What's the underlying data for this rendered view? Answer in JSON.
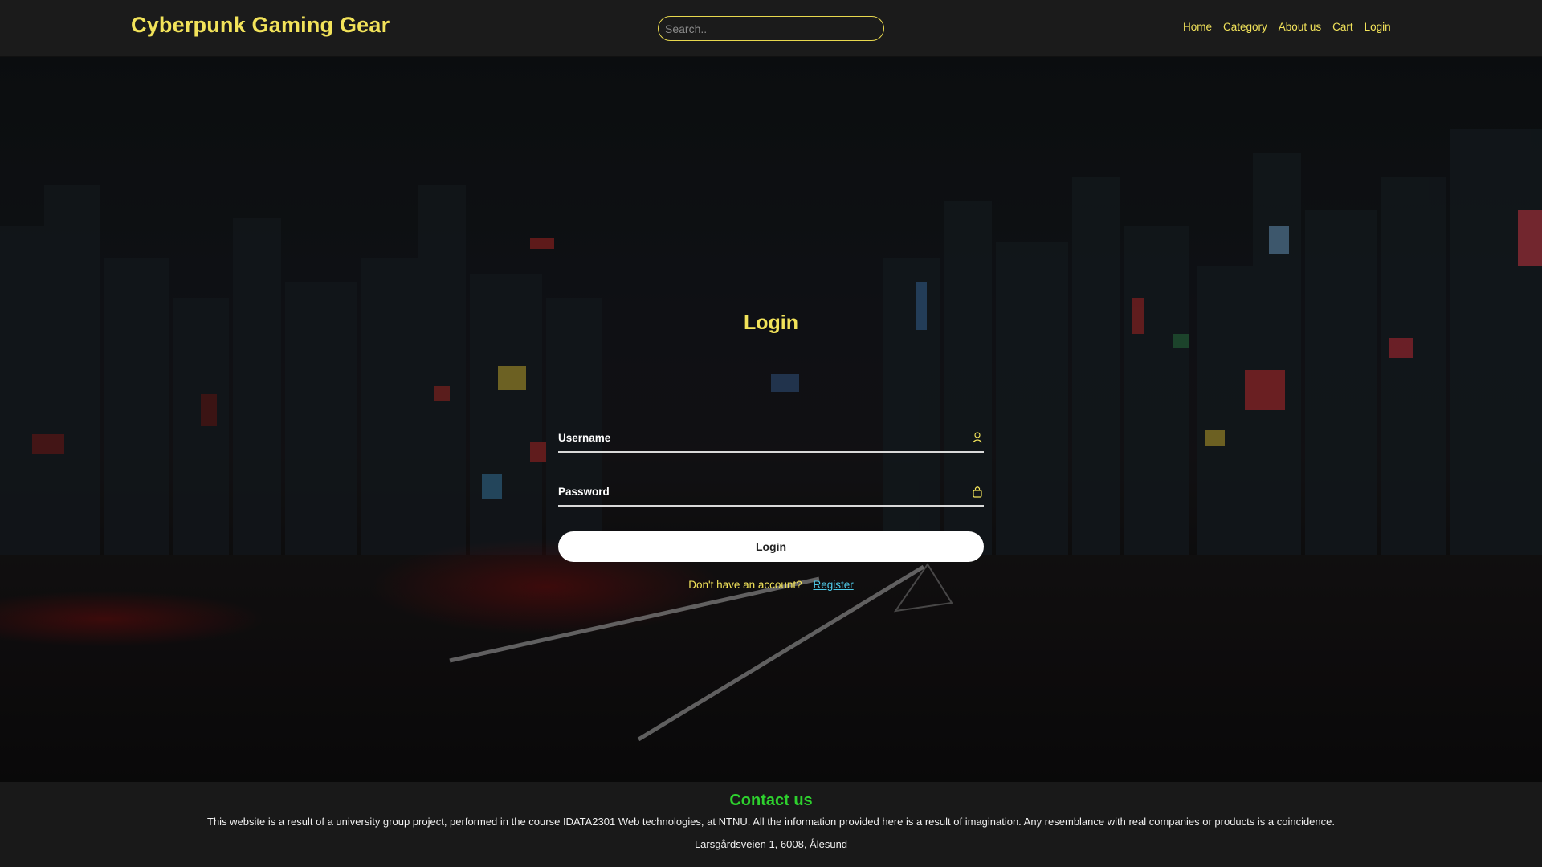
{
  "header": {
    "brand": "Cyberpunk Gaming Gear",
    "search_placeholder": "Search..",
    "nav": [
      "Home",
      "Category",
      "About us",
      "Cart",
      "Login"
    ]
  },
  "login": {
    "title": "Login",
    "username_label": "Username",
    "password_label": "Password",
    "button_label": "Login",
    "register_prompt": "Don't have an account?",
    "register_link": "Register"
  },
  "footer": {
    "title": "Contact us",
    "description": "This website is a result of a university group project, performed in the course IDATA2301 Web technologies, at NTNU. All the information provided here is a result of imagination. Any resemblance with real companies or products is a coincidence.",
    "address": "Larsgårdsveien 1, 6008, Ålesund"
  },
  "colors": {
    "accent": "#f2e35a",
    "link": "#4fc9e8",
    "footer_title": "#2ed12e",
    "header_bg": "#1b1b1b"
  },
  "icons": {
    "username": "user-icon",
    "password": "lock-icon"
  }
}
